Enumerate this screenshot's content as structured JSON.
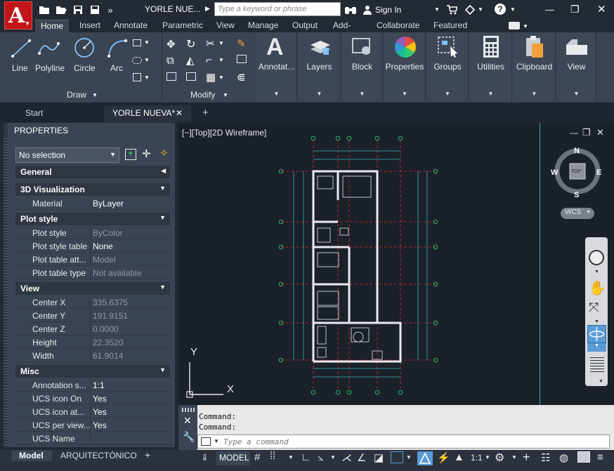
{
  "titlebar": {
    "app_letter": "A",
    "document_title": "YORLE NUE...",
    "search_placeholder": "Type a keyword or phrase",
    "sign_in": "Sign In",
    "overflow": "»",
    "help": "?",
    "window_min": "—",
    "window_max": "❐",
    "window_close": "✕"
  },
  "ribbon_tabs": [
    "Home",
    "Insert",
    "Annotate",
    "Parametric",
    "View",
    "Manage",
    "Output",
    "Add-ins",
    "Collaborate",
    "Featured Apps"
  ],
  "ribbon": {
    "draw": {
      "title": "Draw",
      "tools": [
        "Line",
        "Polyline",
        "Circle",
        "Arc"
      ]
    },
    "modify": {
      "title": "Modify"
    },
    "big_buttons": [
      "Annotat...",
      "Layers",
      "Block",
      "Properties",
      "Groups",
      "Utilities",
      "Clipboard",
      "View"
    ]
  },
  "file_tabs": {
    "start": "Start",
    "active": "YORLE NUEVA*",
    "close": "✕",
    "add": "+"
  },
  "properties": {
    "title": "PROPERTIES",
    "selection": "No selection",
    "sections": [
      {
        "name": "General",
        "collapsed": true,
        "rows": []
      },
      {
        "name": "3D Visualization",
        "rows": [
          {
            "k": "Material",
            "v": "ByLayer"
          }
        ]
      },
      {
        "name": "Plot style",
        "rows": [
          {
            "k": "Plot style",
            "v": "ByColor",
            "dim": true
          },
          {
            "k": "Plot style table",
            "v": "None"
          },
          {
            "k": "Plot table att...",
            "v": "Model",
            "dim": true
          },
          {
            "k": "Plot table type",
            "v": "Not available",
            "dim": true
          }
        ]
      },
      {
        "name": "View",
        "rows": [
          {
            "k": "Center X",
            "v": "335.6375",
            "dim": true
          },
          {
            "k": "Center Y",
            "v": "191.9151",
            "dim": true
          },
          {
            "k": "Center Z",
            "v": "0.0000",
            "dim": true
          },
          {
            "k": "Height",
            "v": "22.3520",
            "dim": true
          },
          {
            "k": "Width",
            "v": "61.9014",
            "dim": true
          }
        ]
      },
      {
        "name": "Misc",
        "rows": [
          {
            "k": "Annotation s...",
            "v": "1:1"
          },
          {
            "k": "UCS icon On",
            "v": "Yes"
          },
          {
            "k": "UCS icon at...",
            "v": "Yes"
          },
          {
            "k": "UCS per view...",
            "v": "Yes"
          },
          {
            "k": "UCS Name",
            "v": ""
          }
        ]
      }
    ]
  },
  "viewport": {
    "label": "[−][Top][2D Wireframe]",
    "compass": {
      "n": "N",
      "s": "S",
      "e": "E",
      "w": "W",
      "top": "TOP"
    },
    "wcs": "WCS",
    "ucs_x": "X",
    "ucs_y": "Y"
  },
  "command": {
    "history": [
      "Command:",
      "Command:"
    ],
    "placeholder": "Type a command"
  },
  "layout_tabs": {
    "model": "Model",
    "layout": "ARQUITECTÓNICO",
    "add": "+"
  },
  "status": {
    "model": "MODEL",
    "scale": "1:1"
  },
  "colors": {
    "accent_red": "#c0161b",
    "ribbon_bg": "#3b4453",
    "canvas_bg": "#1b2129",
    "grid_red": "#e0262a",
    "dim_cyan": "#2fb5b5"
  }
}
